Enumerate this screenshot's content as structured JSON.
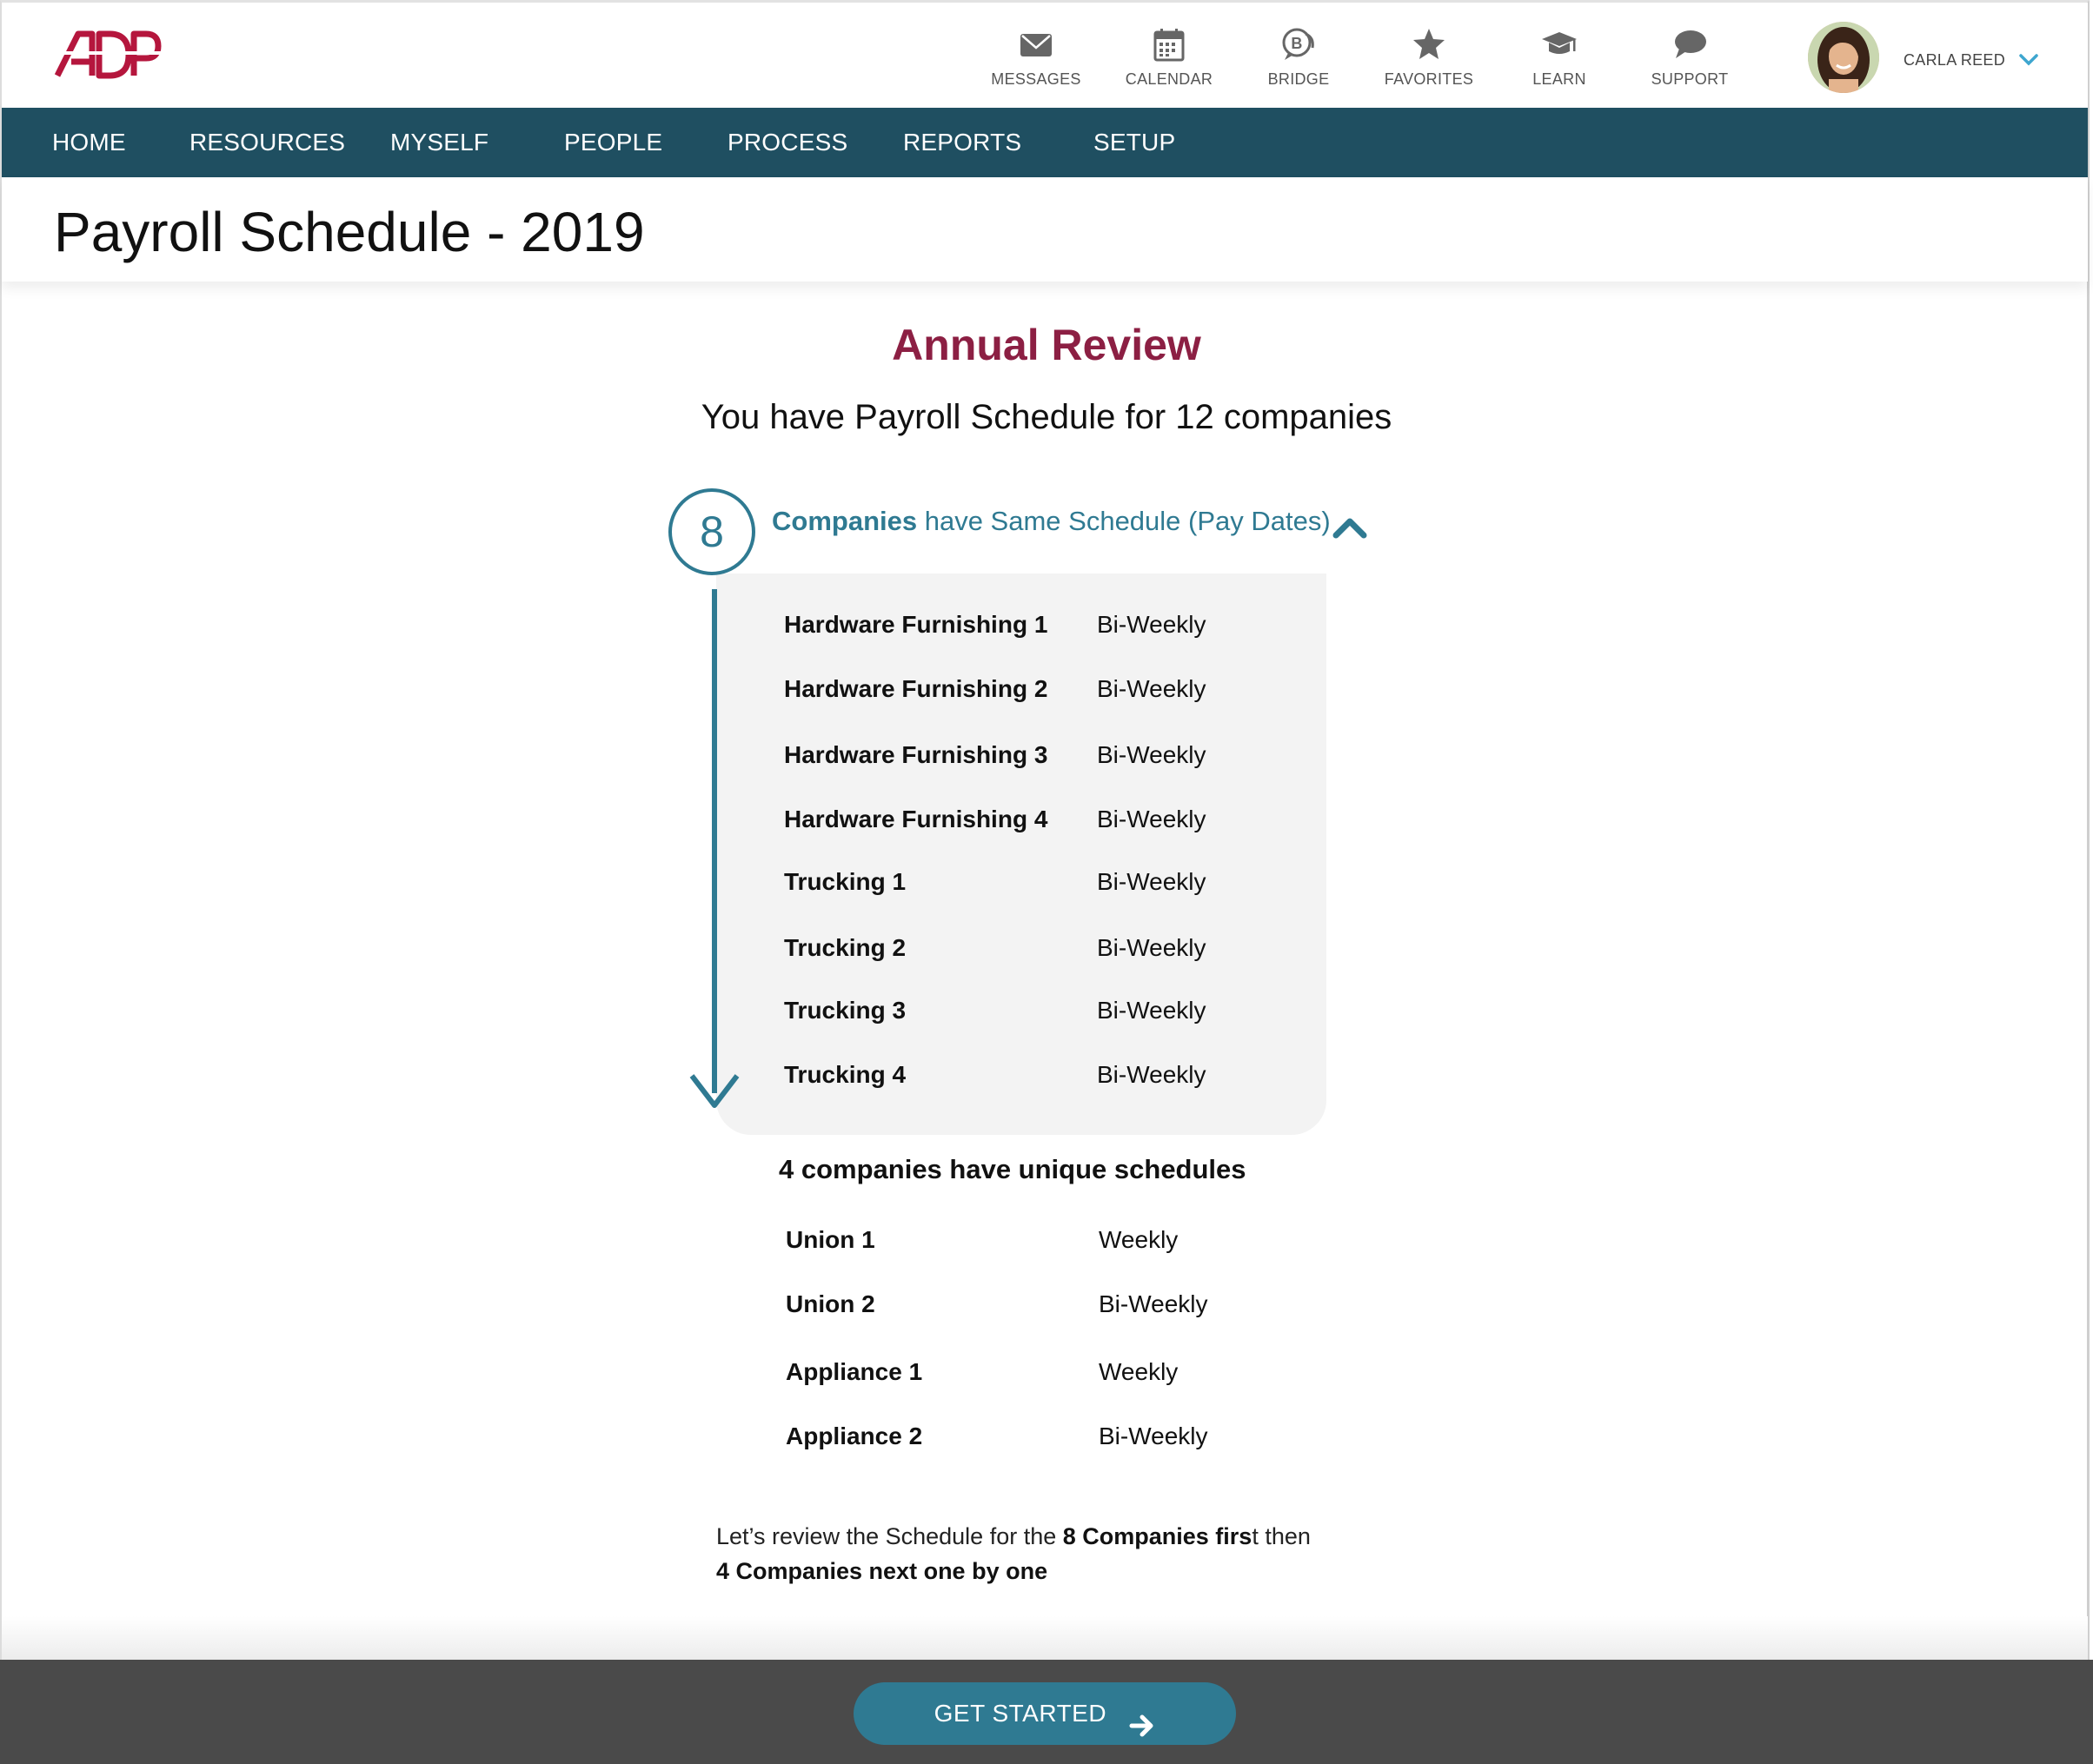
{
  "app": {
    "brand": "ADP",
    "brand_color": "#b5163d"
  },
  "utility_nav": [
    {
      "label": "MESSAGES",
      "icon": "envelope-icon"
    },
    {
      "label": "CALENDAR",
      "icon": "calendar-icon"
    },
    {
      "label": "BRIDGE",
      "icon": "bridge-chat-icon"
    },
    {
      "label": "FAVORITES",
      "icon": "star-icon"
    },
    {
      "label": "LEARN",
      "icon": "graduation-cap-icon"
    },
    {
      "label": "SUPPORT",
      "icon": "speech-bubble-icon"
    }
  ],
  "user": {
    "name": "CARLA REED",
    "menu_icon": "chevron-down-icon"
  },
  "main_nav": [
    "HOME",
    "RESOURCES",
    "MYSELF",
    "PEOPLE",
    "PROCESS",
    "REPORTS",
    "SETUP"
  ],
  "page": {
    "title": "Payroll Schedule - 2019"
  },
  "review": {
    "heading": "Annual Review",
    "subtitle": "You have Payroll Schedule for 12 companies",
    "same_group": {
      "count": "8",
      "label_bold": "Companies",
      "label_rest": " have Same Schedule (Pay Dates)",
      "toggle_icon": "chevron-up-icon",
      "companies": [
        {
          "name": "Hardware Furnishing 1",
          "schedule": "Bi-Weekly"
        },
        {
          "name": "Hardware Furnishing 2",
          "schedule": "Bi-Weekly"
        },
        {
          "name": "Hardware Furnishing 3",
          "schedule": "Bi-Weekly"
        },
        {
          "name": "Hardware Furnishing 4",
          "schedule": "Bi-Weekly"
        },
        {
          "name": "Trucking 1",
          "schedule": "Bi-Weekly"
        },
        {
          "name": "Trucking 2",
          "schedule": "Bi-Weekly"
        },
        {
          "name": "Trucking 3",
          "schedule": "Bi-Weekly"
        },
        {
          "name": "Trucking 4",
          "schedule": "Bi-Weekly"
        }
      ]
    },
    "unique_group": {
      "heading": "4 companies have unique schedules",
      "companies": [
        {
          "name": "Union 1",
          "schedule": "Weekly"
        },
        {
          "name": "Union 2",
          "schedule": "Bi-Weekly"
        },
        {
          "name": "Appliance 1",
          "schedule": "Weekly"
        },
        {
          "name": "Appliance 2",
          "schedule": "Bi-Weekly"
        }
      ]
    },
    "footer": {
      "part1": "Let’s review the Schedule for the ",
      "bold1": "8 Companies firs",
      "part2": "t then",
      "bold2": "4  Companies next one by one"
    }
  },
  "action": {
    "button_label": "GET STARTED",
    "button_icon": "arrow-right-icon"
  },
  "colors": {
    "nav_bg": "#1f4f61",
    "accent": "#2f7a92",
    "heading": "#8c1f43",
    "action_bar": "#4a4a4a"
  }
}
